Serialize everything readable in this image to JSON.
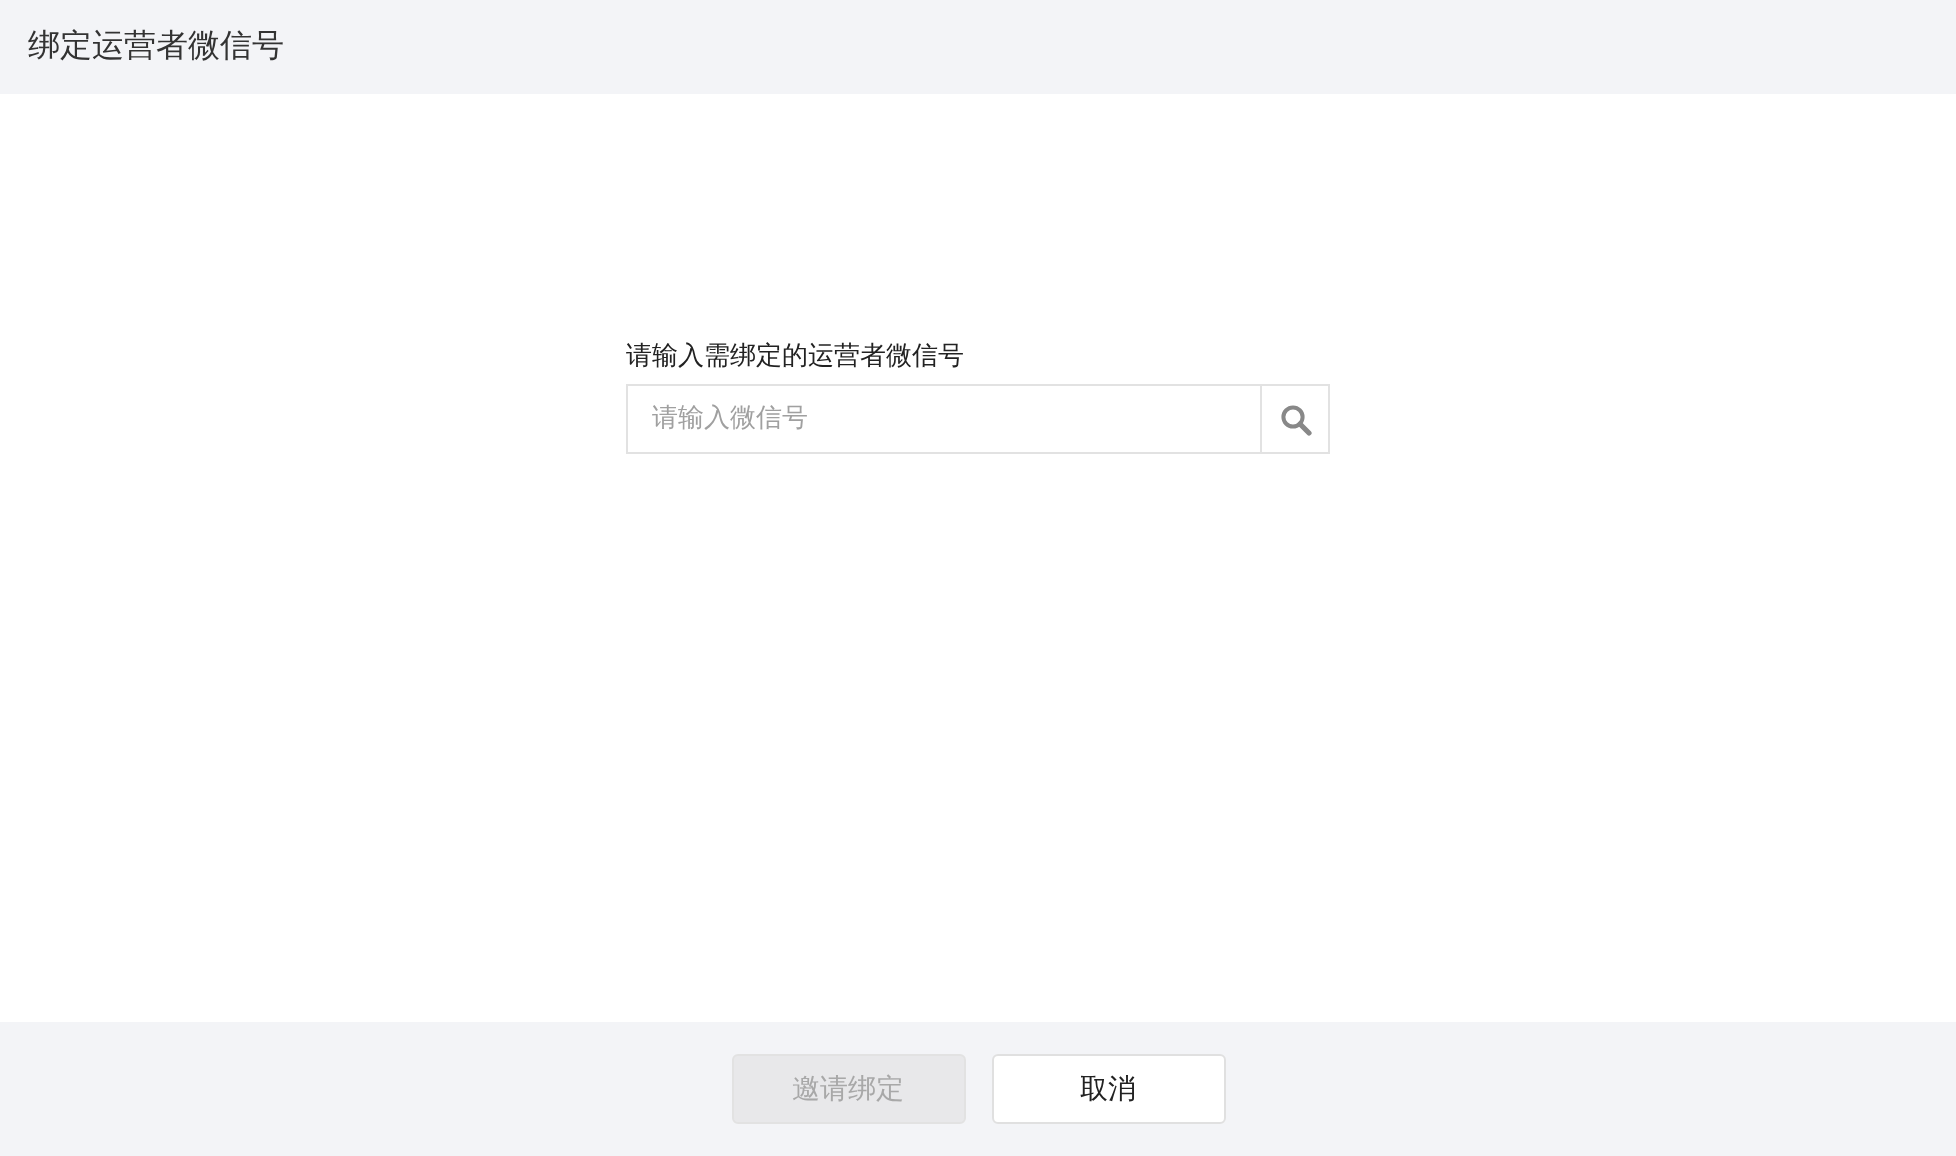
{
  "dialog": {
    "title": "绑定运营者微信号"
  },
  "form": {
    "label": "请输入需绑定的运营者微信号",
    "search": {
      "placeholder": "请输入微信号"
    }
  },
  "buttons": [
    {
      "label": "邀请绑定",
      "disabled": true
    },
    {
      "label": "取消",
      "disabled": false
    }
  ]
}
